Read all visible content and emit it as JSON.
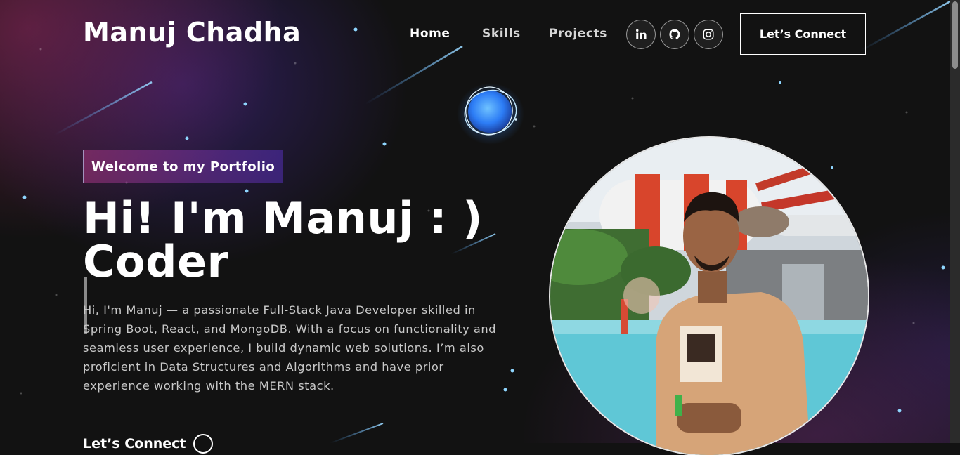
{
  "navbar": {
    "brand": "Manuj Chadha",
    "links": [
      {
        "label": "Home",
        "active": true
      },
      {
        "label": "Skills",
        "active": false
      },
      {
        "label": "Projects",
        "active": false
      }
    ],
    "social": [
      "linkedin-icon",
      "github-icon",
      "instagram-icon"
    ],
    "connect_label": "Let’s Connect"
  },
  "banner": {
    "tagline": "Welcome to my Portfolio",
    "headline_line1": "Hi! I'm Manuj : )",
    "headline_line2": "Coder",
    "intro": "Hi, I'm Manuj — a passionate Full-Stack Java Developer skilled in Spring Boot, React, and MongoDB. With a focus on functionality and seamless user experience, I build dynamic web solutions. I’m also proficient in Data Structures and Algorithms and have prior experience working with the MERN stack.",
    "cta_label": "Let’s Connect",
    "photo_icon": "profile-photo",
    "orb_icon": "astronaut-orb-icon"
  },
  "colors": {
    "background": "#121212",
    "accent_pink": "#aa367c",
    "accent_purple": "#4a2fbd",
    "star": "#8fd6ff"
  }
}
